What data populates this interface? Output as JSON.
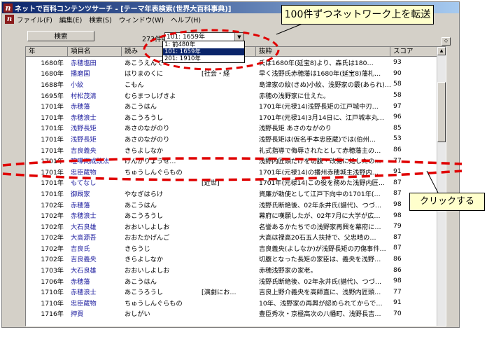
{
  "window": {
    "app_icon": "n",
    "title": "ネットで百科コンテンツサーチ - [テーマ年表検索(世界大百科事典)]"
  },
  "menu": {
    "icon": "n",
    "items": [
      "ファイル(F)",
      "編集(E)",
      "検索(S)",
      "ウィンドウ(W)",
      "ヘルプ(H)"
    ]
  },
  "search": {
    "button_label": "検索",
    "count_label": "273件中",
    "combo_value": "101: 1659年",
    "combo_arrow": "▼",
    "options": [
      "1: 前480年",
      "101: 1659年",
      "201: 1910年"
    ],
    "selected_index": 1,
    "side_button": "◇"
  },
  "table": {
    "headers": [
      "年",
      "項目名",
      "読み",
      "",
      "抜粋",
      "スコア"
    ],
    "rows": [
      [
        "1680年",
        "赤穂塩田",
        "あこうえんで",
        "",
        "氏は1680年(延宝8)より、森氏は180…",
        "93"
      ],
      [
        "1680年",
        "播磨国",
        "はりまのくに",
        "[社会・経",
        "早く浅野氏赤穂藩は1680年(延宝8)藩札…",
        "90"
      ],
      [
        "1688年",
        "小紋",
        "こもん",
        "",
        "島津家の紋(きぬ)小紋、浅野家の霰(あられ)…",
        "58"
      ],
      [
        "1695年",
        "村松茂清",
        "むらまつしげきよ",
        "",
        "赤穂の浅野家に仕えた。",
        "58"
      ],
      [
        "1701年",
        "赤穂藩",
        "あこうはん",
        "",
        "1701年(元禄14)浅野長矩の江戸城中刃…",
        "97"
      ],
      [
        "1701年",
        "赤穂浪士",
        "あこうろうし",
        "",
        "1701年(元禄14)3月14日に、江戸城本丸…",
        "96"
      ],
      [
        "1701年",
        "浅野長矩",
        "あさのながのり",
        "",
        "浅野長矩 あさのながのり",
        "85"
      ],
      [
        "1701年",
        "浅野長矩",
        "あさのながのり",
        "",
        "浅野長矩は(仮名手本忠臣蔵)では(伯州…",
        "53"
      ],
      [
        "1701年",
        "吉良義央",
        "きらよしなか",
        "",
        "礼式指導で侮辱されたとして赤穂藩主の…",
        "86"
      ],
      [
        "1701年",
        "喧嘩両成敗法",
        "けんかりょうせ…",
        "",
        "浅野内匠頭だけを切腹・改易に処したの…",
        "77"
      ],
      [
        "1701年",
        "忠臣蔵物",
        "ちゅうしんぐらもの",
        "",
        "1701年(元禄14)の播州赤穂城主浅野内…",
        "91"
      ],
      [
        "1701年",
        "もてなし",
        "",
        "[近世]",
        "1701年(元禄14)この役を務めた浅野内匠…",
        "87"
      ],
      [
        "1701年",
        "御厩家",
        "やなぎはらけ",
        "",
        "資廉が勅使として江戸下向中の1701年(…",
        "87"
      ],
      [
        "1702年",
        "赤穂藩",
        "あこうはん",
        "",
        "浅野氏断絶後、02年永井氏(譜代)、つづ…",
        "98"
      ],
      [
        "1702年",
        "赤穂浪士",
        "あこうろうし",
        "",
        "幕府に嘆願したが、02年7月に大学が広…",
        "98"
      ],
      [
        "1702年",
        "大石良雄",
        "おおいしよしお",
        "",
        "名誉あるかたちでの浅野家再興を幕府に…",
        "79"
      ],
      [
        "1702年",
        "大高源吾",
        "おおたかげんご",
        "",
        "大高は禄高20石五人扶持で、父忠晴の…",
        "87"
      ],
      [
        "1702年",
        "吉良氏",
        "きらうじ",
        "",
        "吉良義央(よしなか)が浅野長矩の刃傷事件…",
        "87"
      ],
      [
        "1702年",
        "吉良義央",
        "きらよしなか",
        "",
        "切腹となった長矩の家臣は、義央を浅野…",
        "86"
      ],
      [
        "1703年",
        "大石良雄",
        "おおいしよしお",
        "",
        "赤穂浅野家の家老。",
        "86"
      ],
      [
        "1706年",
        "赤穂藩",
        "あこうはん",
        "",
        "浅野氏断絶後、02年永井氏(譜代)、つづ…",
        "98"
      ],
      [
        "1710年",
        "赤穂浪士",
        "あこうろうし",
        "[演劇にお…",
        "吉良上野介義央を高師直に、浅野内匠頭…",
        "77"
      ],
      [
        "1710年",
        "忠臣蔵物",
        "ちゅうしんぐらもの",
        "",
        "10年、浅野家の再興が認められてからで…",
        "91"
      ],
      [
        "1716年",
        "押買",
        "おしがい",
        "",
        "豊臣秀次・京極高次の八幡町、浅野長吉…",
        "70"
      ]
    ]
  },
  "annotations": {
    "top_callout": "100件ずつネットワーク上を転送",
    "right_callout": "クリックする",
    "color": "#e00000"
  }
}
